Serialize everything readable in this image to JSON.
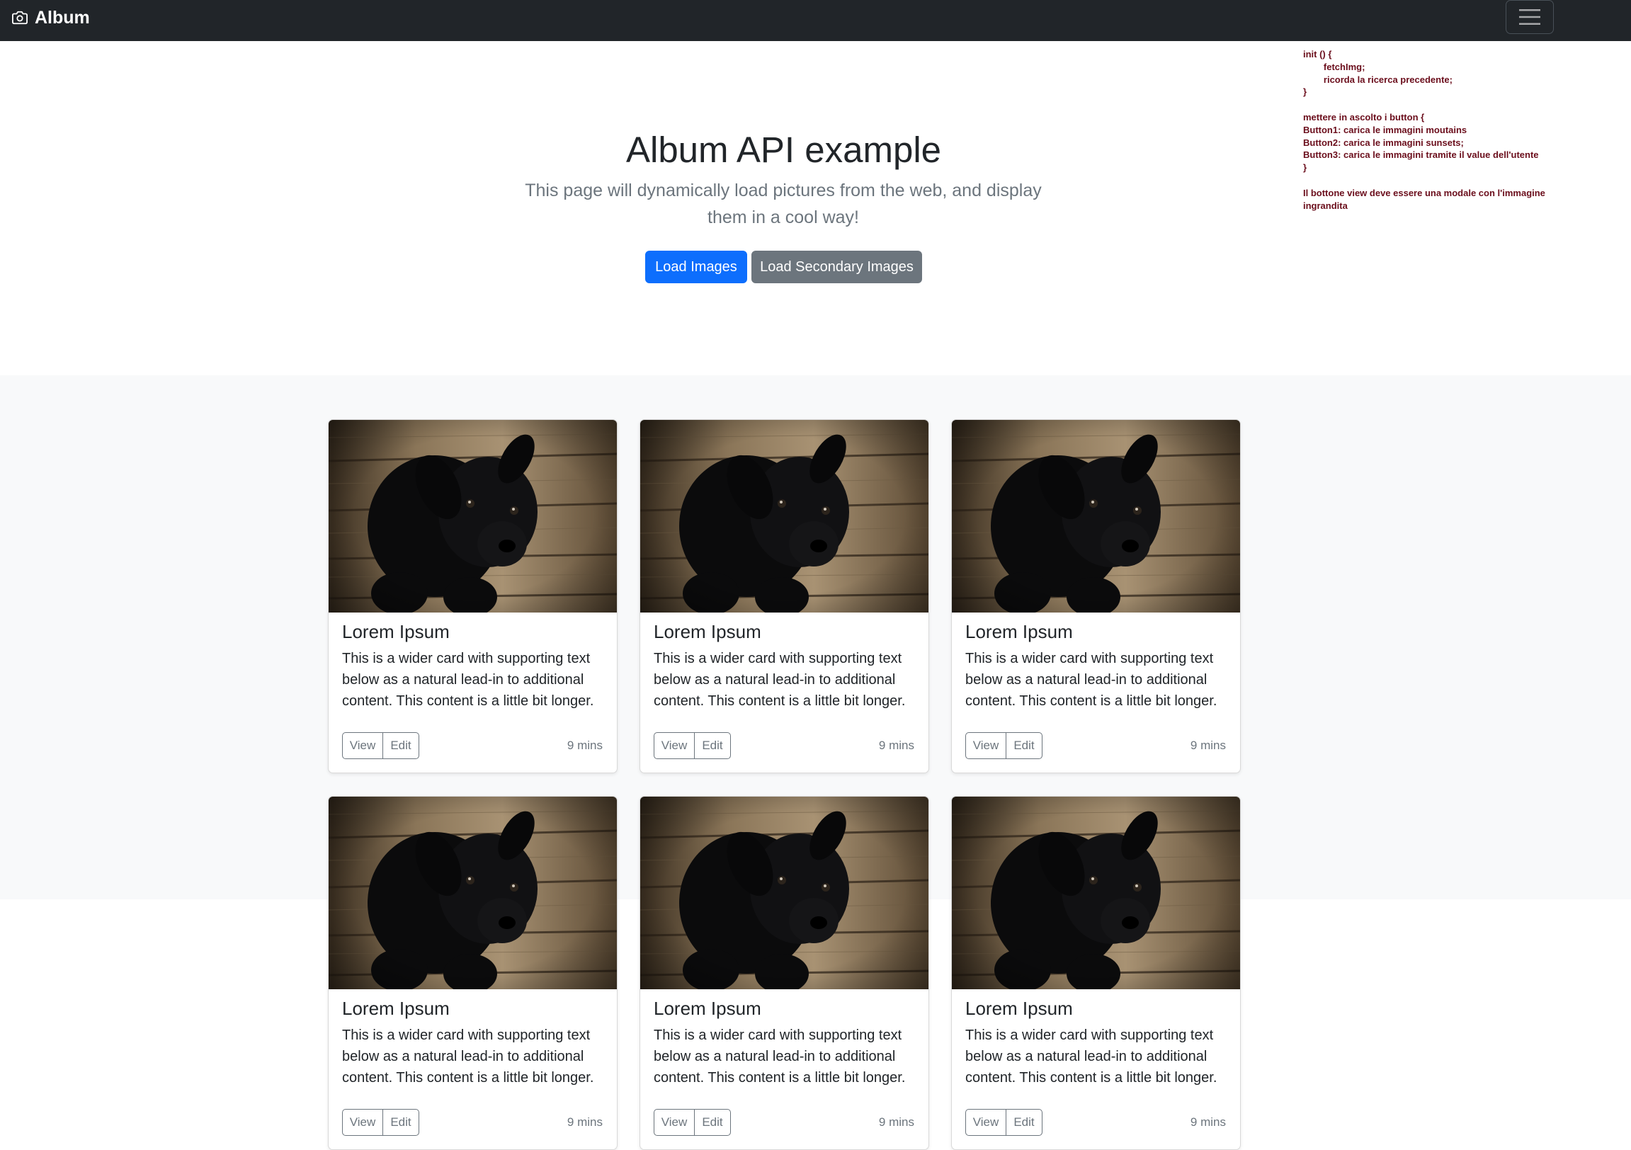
{
  "navbar": {
    "brand": "Album",
    "brand_icon": "camera-icon",
    "toggler_icon": "hamburger-menu-icon"
  },
  "hero": {
    "title": "Album API example",
    "lead": "This page will dynamically load pictures from the web, and display them in a cool way!",
    "primary_button": "Load Images",
    "secondary_button": "Load Secondary Images"
  },
  "notes": "init () {\n        fetchImg;\n        ricorda la ricerca precedente;\n}\n\nmettere in ascolto i button {\nButton1: carica le immagini moutains\nButton2: carica le immagini sunsets;\nButton3: carica le immagini tramite il value dell'utente\n}\n\nIl bottone view deve essere una modale con l'immagine\ningrandita",
  "cards": [
    {
      "title": "Lorem Ipsum",
      "text": "This is a wider card with supporting text below as a natural lead-in to additional content. This content is a little bit longer.",
      "view": "View",
      "edit": "Edit",
      "time": "9 mins"
    },
    {
      "title": "Lorem Ipsum",
      "text": "This is a wider card with supporting text below as a natural lead-in to additional content. This content is a little bit longer.",
      "view": "View",
      "edit": "Edit",
      "time": "9 mins"
    },
    {
      "title": "Lorem Ipsum",
      "text": "This is a wider card with supporting text below as a natural lead-in to additional content. This content is a little bit longer.",
      "view": "View",
      "edit": "Edit",
      "time": "9 mins"
    },
    {
      "title": "Lorem Ipsum",
      "text": "This is a wider card with supporting text below as a natural lead-in to additional content. This content is a little bit longer.",
      "view": "View",
      "edit": "Edit",
      "time": "9 mins"
    },
    {
      "title": "Lorem Ipsum",
      "text": "This is a wider card with supporting text below as a natural lead-in to additional content. This content is a little bit longer.",
      "view": "View",
      "edit": "Edit",
      "time": "9 mins"
    },
    {
      "title": "Lorem Ipsum",
      "text": "This is a wider card with supporting text below as a natural lead-in to additional content. This content is a little bit longer.",
      "view": "View",
      "edit": "Edit",
      "time": "9 mins"
    }
  ],
  "colors": {
    "navbar_bg": "#212529",
    "primary": "#0d6efd",
    "secondary": "#6c757d",
    "album_bg": "#f8f9fa",
    "notes_text": "#6b0e1c"
  }
}
